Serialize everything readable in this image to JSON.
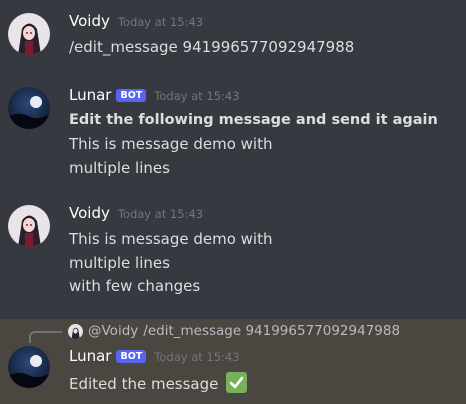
{
  "messages": [
    {
      "author": "Voidy",
      "timestamp": "Today at 15:43",
      "lines": [
        "/edit_message 941996577092947988"
      ],
      "avatar_icon": "anime-avatar"
    },
    {
      "author": "Lunar",
      "bot_tag": "BOT",
      "timestamp": "Today at 15:43",
      "bold_line": "Edit the following message and send it again",
      "lines": [
        "This is message demo with",
        "multiple lines"
      ],
      "avatar_icon": "moon-avatar"
    },
    {
      "author": "Voidy",
      "timestamp": "Today at 15:43",
      "lines": [
        "This is message demo with",
        "multiple lines",
        "with few changes"
      ],
      "avatar_icon": "anime-avatar"
    },
    {
      "reply": {
        "mention": "@Voidy",
        "content": "/edit_message 941996577092947988"
      },
      "author": "Lunar",
      "bot_tag": "BOT",
      "timestamp": "Today at 15:43",
      "lines": [
        "Edited the message"
      ],
      "emoji": "white-check-mark",
      "avatar_icon": "moon-avatar"
    }
  ],
  "colors": {
    "background": "#36393f",
    "highlight": "#4a4640",
    "bot_tag": "#5865f2",
    "check_emoji": "#78b159"
  }
}
